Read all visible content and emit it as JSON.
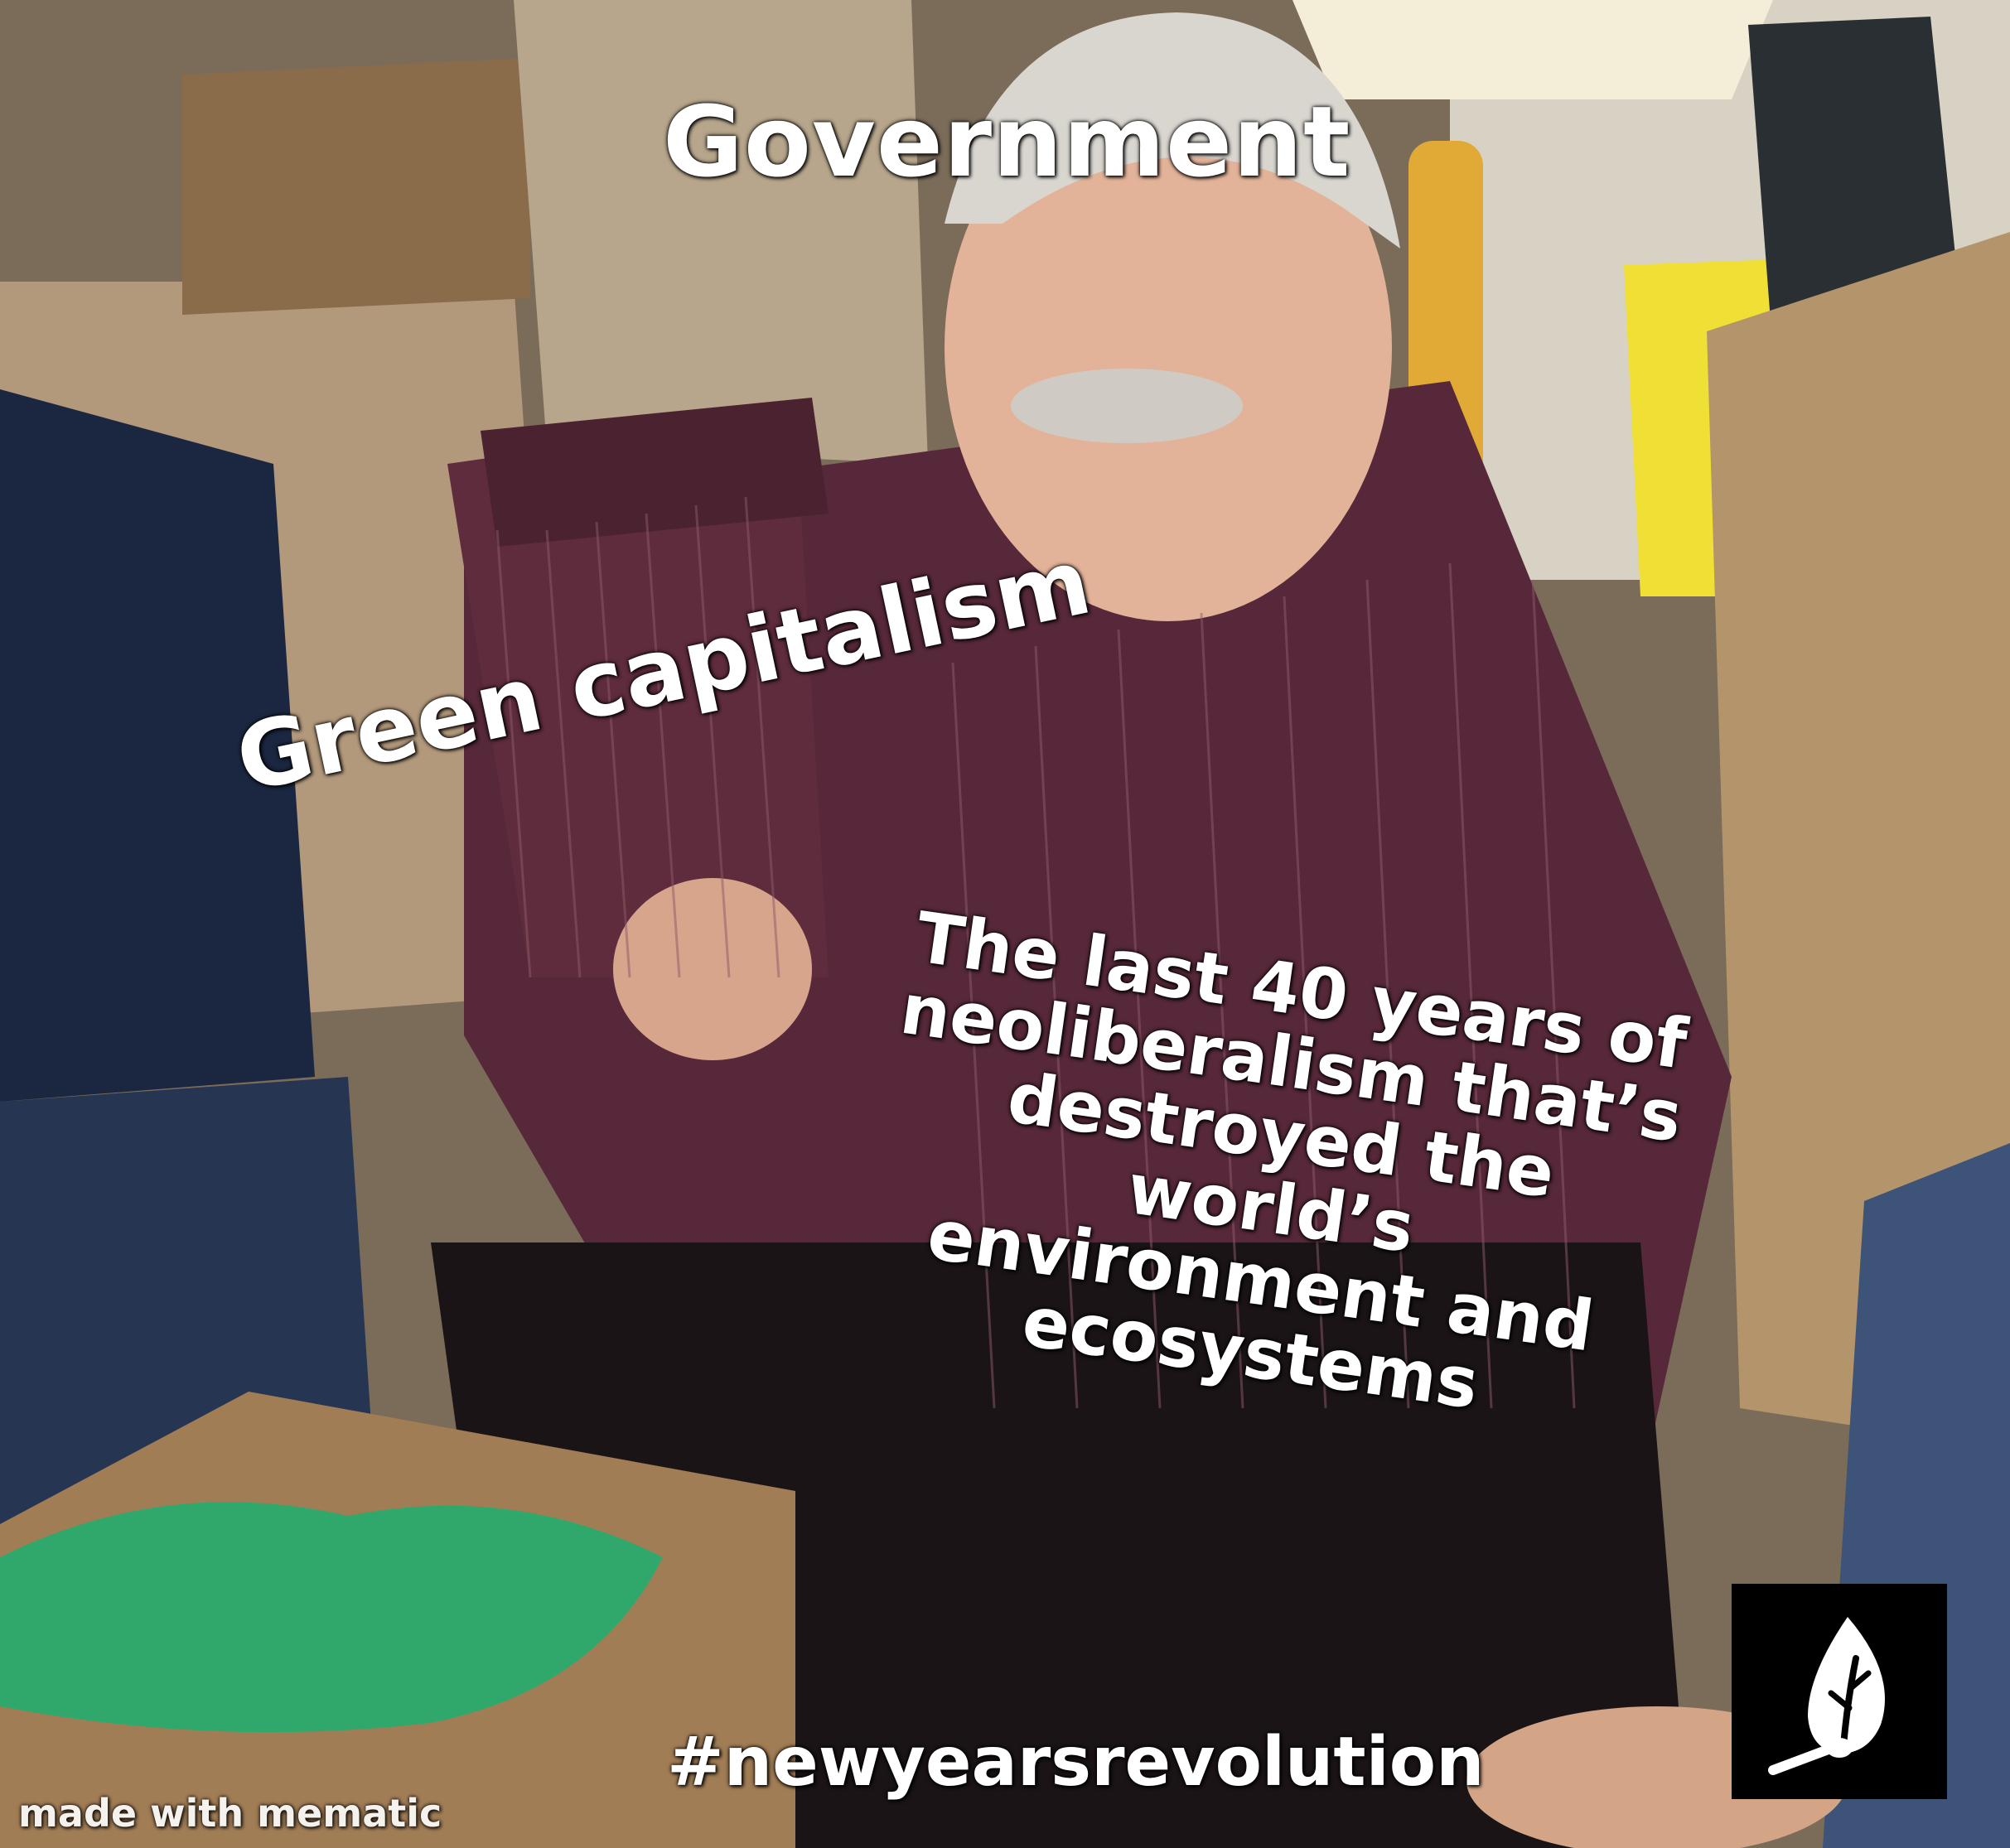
{
  "captions": {
    "government": "Government",
    "green_capitalism": "Green capitalism",
    "neoliberalism_lines": [
      "The last 40 years of",
      "neoliberalism that’s",
      "destroyed the world’s",
      "environment and",
      "ecosystems"
    ],
    "hashtag": "#newyearsrevolution",
    "watermark": "made with mematic"
  },
  "logo": {
    "icon": "leaf-match-icon",
    "background_color": "#000000",
    "icon_color": "#ffffff"
  },
  "scene": {
    "shirt_color": "#5a2a35",
    "tissue_color": "#2fa86a",
    "box_color": "#9c7a54",
    "lamp_color": "#e8b63a",
    "bag_color": "#f3e33a"
  }
}
